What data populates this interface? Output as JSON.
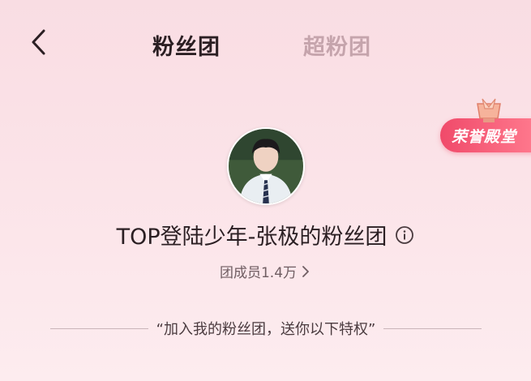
{
  "header": {
    "tabs": [
      {
        "label": "粉丝团",
        "active": true
      },
      {
        "label": "超粉团",
        "active": false
      }
    ]
  },
  "honor_badge": {
    "label": "荣誉殿堂",
    "icon": "trophy-icon"
  },
  "fan_group": {
    "name": "TOP登陆少年-张极的粉丝团",
    "member_text": "团成员1.4万"
  },
  "benefits": {
    "heading": "“加入我的粉丝团，送你以下特权”"
  },
  "colors": {
    "background": "#f9dde3",
    "accent": "#f04a6a",
    "tab_inactive": "#c5a4ac"
  }
}
